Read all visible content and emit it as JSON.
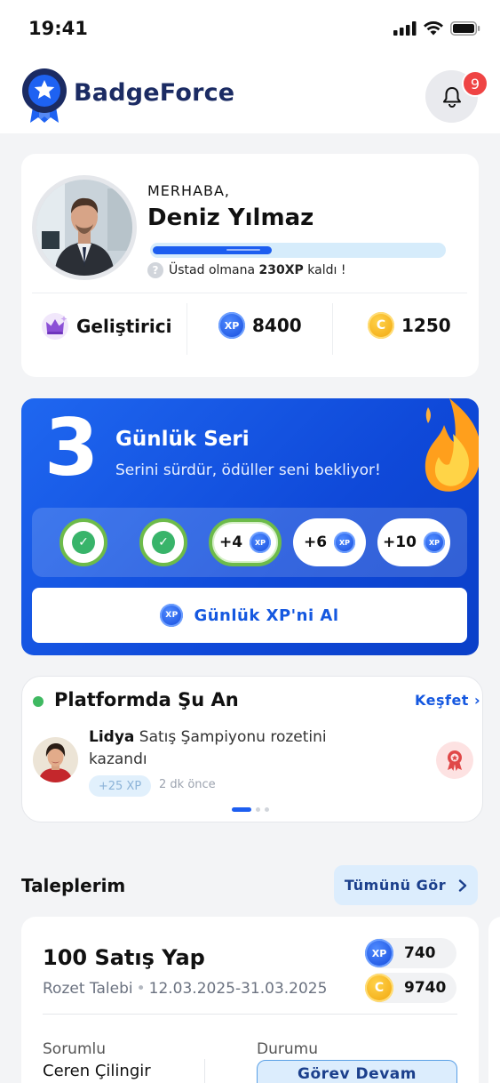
{
  "status_bar": {
    "time": "19:41"
  },
  "header": {
    "brand": "BadgeForce",
    "notification_count": "9"
  },
  "profile": {
    "greeting": "MERHABA,",
    "name": "Deniz Yılmaz",
    "progress_fraction": 0.41,
    "hint_prefix": "Üstad olmana ",
    "hint_xp": "230XP",
    "hint_suffix": " kaldı !",
    "role": "Geliştirici",
    "xp_total": "8400",
    "coins_total": "1250",
    "xp_coin_label": "XP",
    "gold_coin_label": "C"
  },
  "streak": {
    "count": "3",
    "title": "Günlük Seri",
    "subtitle": "Serini sürdür, ödüller seni bekliyor!",
    "days": [
      {
        "state": "done"
      },
      {
        "state": "done"
      },
      {
        "state": "current",
        "reward": "+4"
      },
      {
        "state": "future",
        "reward": "+6"
      },
      {
        "state": "future",
        "reward": "+10"
      }
    ],
    "claim_label": "Günlük XP'ni Al"
  },
  "live": {
    "title": "Platformda Şu An",
    "explore_label": "Keşfet",
    "user": "Lidya",
    "action": " Satış Şampiyonu rozetini kazandı",
    "xp": "+25 XP",
    "time_ago": "2 dk önce"
  },
  "requests": {
    "title": "Taleplerim",
    "see_all_label": "Tümünü Gör",
    "card": {
      "title": "100 Satış Yap",
      "type": "Rozet Talebi",
      "date_range": "12.03.2025-31.03.2025",
      "xp_reward": "740",
      "coin_reward": "9740",
      "owner_label": "Sorumlu",
      "owner": "Ceren Çilingir",
      "state_label": "Durumu",
      "state": "Görev Devam"
    }
  },
  "colors": {
    "brand_navy": "#1b2b63",
    "primary_blue": "#1558e0",
    "success_green": "#38b46a",
    "alert_red": "#ef4444",
    "gold": "#f0a30a"
  },
  "icons": {
    "logo": "star-ribbon-badge-icon",
    "bell": "bell-icon",
    "role": "crown-icon",
    "fire": "flame-icon",
    "badge": "award-icon"
  }
}
